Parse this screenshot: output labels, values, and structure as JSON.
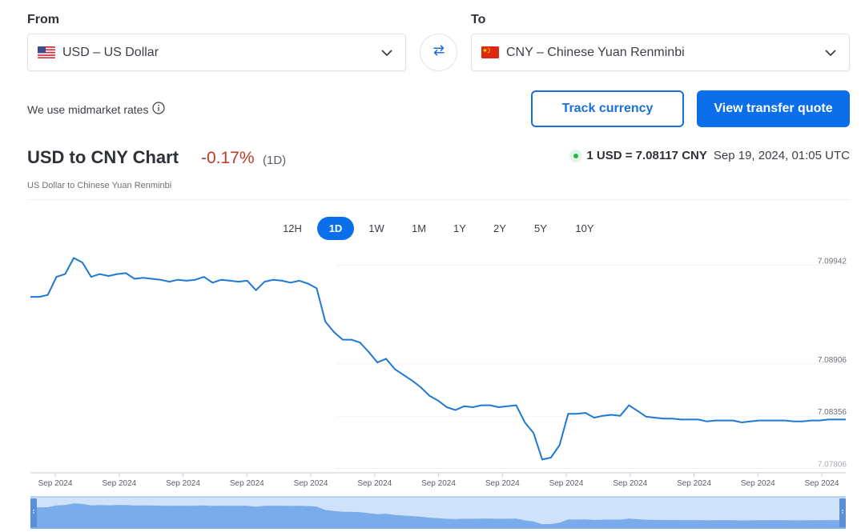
{
  "from": {
    "label": "From",
    "selected": "USD – US Dollar",
    "flag_icon": "us-flag-icon"
  },
  "to": {
    "label": "To",
    "selected": "CNY – Chinese Yuan Renminbi",
    "flag_icon": "china-flag-icon"
  },
  "swap_icon": "swap-arrows-icon",
  "info": {
    "text": "We use midmarket rates",
    "icon": "info-icon"
  },
  "actions": {
    "track": "Track currency",
    "quote": "View transfer quote"
  },
  "header": {
    "title": "USD to CNY Chart",
    "change": "-0.17%",
    "period": "(1D)",
    "subtitle": "US Dollar to Chinese Yuan Renminbi"
  },
  "rate": {
    "value": "1 USD = 7.08117 CNY",
    "timestamp": "Sep 19, 2024, 01:05 UTC"
  },
  "tabs": [
    {
      "label": "12H",
      "active": false
    },
    {
      "label": "1D",
      "active": true
    },
    {
      "label": "1W",
      "active": false
    },
    {
      "label": "1M",
      "active": false
    },
    {
      "label": "1Y",
      "active": false
    },
    {
      "label": "2Y",
      "active": false
    },
    {
      "label": "5Y",
      "active": false
    },
    {
      "label": "10Y",
      "active": false
    }
  ],
  "colors": {
    "accent": "#0a6fe8",
    "line": "#1f78d1",
    "negative": "#c0392b",
    "live": "#2fb34a"
  },
  "chart_data": {
    "type": "line",
    "y_ticks": [
      "7.09942",
      "7.08906",
      "7.08356",
      "7.07806"
    ],
    "y_tick_values": [
      7.09942,
      7.08906,
      7.08356,
      7.07806
    ],
    "ylim": [
      7.0776,
      7.1004
    ],
    "x_tick_labels": [
      "Sep 2024",
      "Sep 2024",
      "Sep 2024",
      "Sep 2024",
      "Sep 2024",
      "Sep 2024",
      "Sep 2024",
      "Sep 2024",
      "Sep 2024",
      "Sep 2024",
      "Sep 2024",
      "Sep 2024",
      "Sep 2024"
    ],
    "series": [
      {
        "values": [
          7.0961,
          7.0961,
          7.0963,
          7.0982,
          7.0985,
          7.1002,
          7.0997,
          7.0982,
          7.0985,
          7.0983,
          7.0985,
          7.0986,
          7.098,
          7.0981,
          7.098,
          7.0979,
          7.0977,
          7.0979,
          7.0978,
          7.0979,
          7.0982,
          7.0976,
          7.0979,
          7.0978,
          7.0977,
          7.0978,
          7.0968,
          7.0977,
          7.0979,
          7.0978,
          7.0976,
          7.0978,
          7.0975,
          7.097,
          7.0935,
          7.0924,
          7.0916,
          7.0916,
          7.0913,
          7.0903,
          7.0892,
          7.0896,
          7.0885,
          7.0879,
          7.0873,
          7.0866,
          7.0857,
          7.0852,
          7.0845,
          7.0842,
          7.0846,
          7.0845,
          7.0847,
          7.0847,
          7.0845,
          7.0846,
          7.0847,
          7.0829,
          7.0818,
          7.079,
          7.0792,
          7.0805,
          7.0838,
          7.0838,
          7.0839,
          7.0834,
          7.0836,
          7.0837,
          7.0836,
          7.0847,
          7.0841,
          7.0835,
          7.0834,
          7.0833,
          7.0833,
          7.0832,
          7.0832,
          7.0832,
          7.083,
          7.0831,
          7.0831,
          7.0831,
          7.0829,
          7.083,
          7.0831,
          7.0831,
          7.0831,
          7.0831,
          7.083,
          7.083,
          7.0831,
          7.0831,
          7.0832,
          7.0832,
          7.0832
        ]
      }
    ]
  }
}
